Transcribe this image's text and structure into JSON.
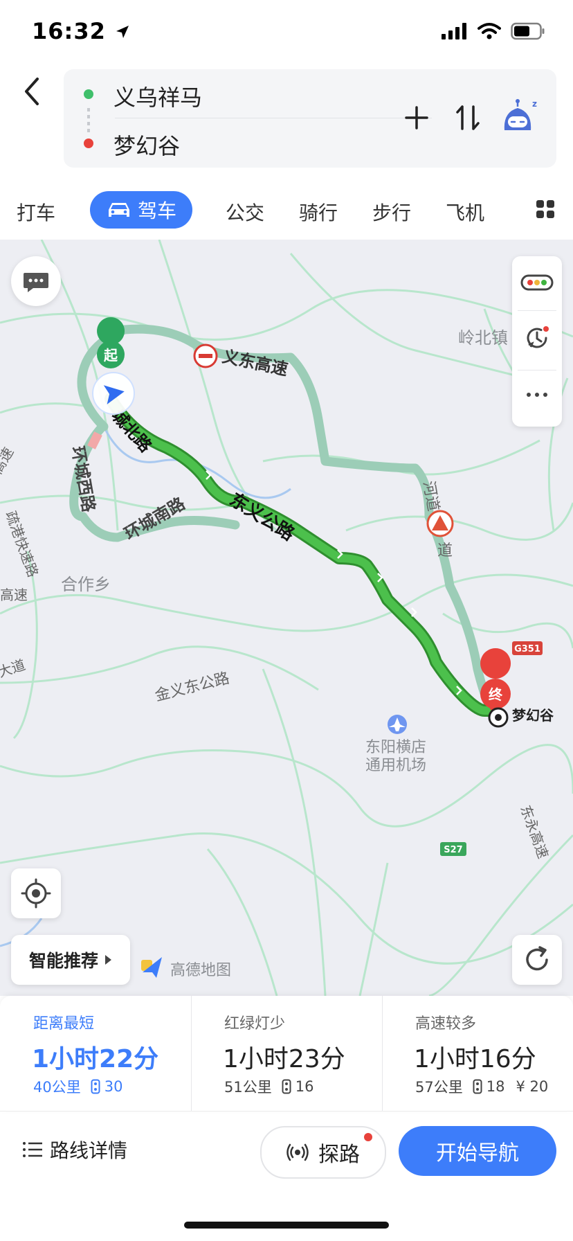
{
  "status_bar": {
    "time": "16:32"
  },
  "route": {
    "origin": "义乌祥马",
    "destination": "梦幻谷"
  },
  "tabs": {
    "taxi": "打车",
    "drive": "驾车",
    "bus": "公交",
    "bike": "骑行",
    "walk": "步行",
    "plane": "飞机"
  },
  "map": {
    "labels": {
      "yidong_expressway": "义东高速",
      "lingbei_town": "岭北镇",
      "chengbei_road": "城北路",
      "huancheng_west": "环城西路",
      "huancheng_south": "环城南路",
      "dongyi_road": "东义公路",
      "shugang_express": "疏港快速路",
      "gaosu_left_top": "高速",
      "gaosu_left": "高速",
      "hezuo_town": "合作乡",
      "dadao": "大道",
      "jinyi_east": "金义东公路",
      "hedao": "河道",
      "dao": "道",
      "dongyang_airport_1": "东阳横店",
      "dongyang_airport_2": "通用机场",
      "destination_label": "梦幻谷",
      "g351": "G351",
      "s27": "S27",
      "dongyong_expressway": "东永高速",
      "start_marker": "起",
      "end_marker": "终",
      "brand": "高德地图"
    },
    "smart_recommend": "智能推荐"
  },
  "options": [
    {
      "label": "距离最短",
      "time": "1小时22分",
      "distance": "40公里",
      "lights": "30",
      "toll": "",
      "active": true
    },
    {
      "label": "红绿灯少",
      "time": "1小时23分",
      "distance": "51公里",
      "lights": "16",
      "toll": "",
      "active": false
    },
    {
      "label": "高速较多",
      "time": "1小时16分",
      "distance": "57公里",
      "lights": "18",
      "toll": "¥ 20",
      "active": false
    }
  ],
  "actions": {
    "details": "路线详情",
    "explore": "探路",
    "navigate": "开始导航"
  },
  "colors": {
    "accent": "#3d7dfa",
    "route_green": "#3fb33f",
    "alt_route": "#9ccdb7",
    "start_green": "#2ea75f",
    "end_red": "#e8423b"
  }
}
